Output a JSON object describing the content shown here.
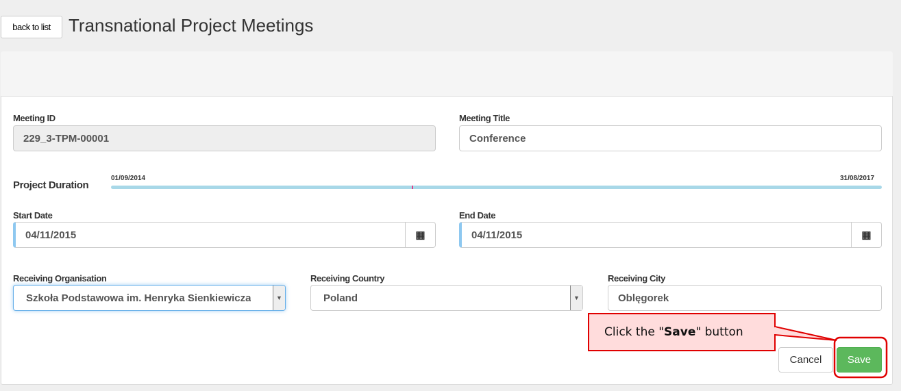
{
  "header": {
    "back_label": "back to list",
    "title": "Transnational Project Meetings"
  },
  "form": {
    "meeting_id": {
      "label": "Meeting ID",
      "value": "229_3-TPM-00001"
    },
    "meeting_title": {
      "label": "Meeting Title",
      "value": "Conference"
    },
    "duration": {
      "label": "Project Duration",
      "start": "01/09/2014",
      "end": "31/08/2017",
      "marker_percent": 39,
      "bar_color": "#a8d8e8",
      "marker_color": "#e0408a"
    },
    "start_date": {
      "label": "Start Date",
      "value": "04/11/2015",
      "icon": "calendar-icon"
    },
    "end_date": {
      "label": "End Date",
      "value": "04/11/2015",
      "icon": "calendar-icon"
    },
    "organisation": {
      "label": "Receiving Organisation",
      "value": "Szkoła Podstawowa im. Henryka Sienkiewicza"
    },
    "country": {
      "label": "Receiving Country",
      "value": "Poland"
    },
    "city": {
      "label": "Receiving City",
      "value": "Oblęgorek"
    }
  },
  "actions": {
    "cancel": "Cancel",
    "save": "Save",
    "save_color": "#5cb85c"
  },
  "callout": {
    "prefix": "Click the \"",
    "bold": "Save",
    "suffix": "\" button",
    "border_color": "#e00000",
    "fill": "#ffdcdc"
  }
}
